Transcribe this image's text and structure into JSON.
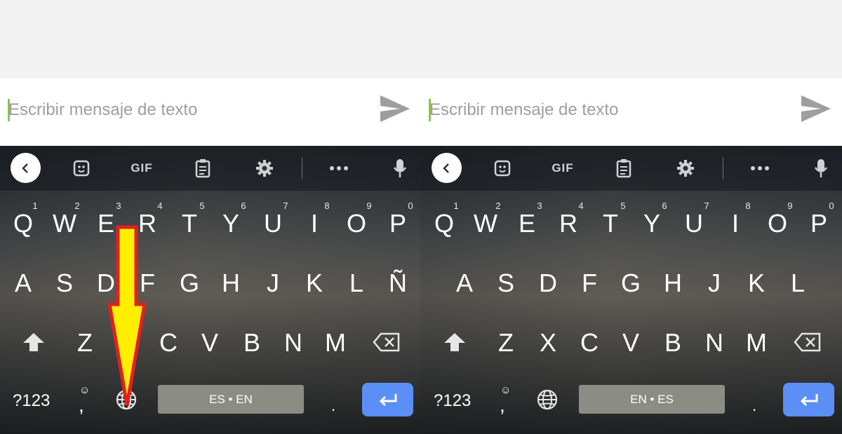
{
  "panels": [
    {
      "id": "left",
      "input": {
        "placeholder": "Escribir mensaje de texto"
      },
      "toolbar": {
        "gif_label": "GIF"
      },
      "rows": {
        "row1": [
          "Q",
          "W",
          "E",
          "R",
          "T",
          "Y",
          "U",
          "I",
          "O",
          "P"
        ],
        "row1_numbers": [
          "1",
          "2",
          "3",
          "4",
          "5",
          "6",
          "7",
          "8",
          "9",
          "0"
        ],
        "row2": [
          "A",
          "S",
          "D",
          "F",
          "G",
          "H",
          "J",
          "K",
          "L",
          "Ñ"
        ],
        "row3": [
          "Z",
          "C",
          "V",
          "B",
          "N",
          "M"
        ]
      },
      "bottom": {
        "symbols": "?123",
        "comma": ",",
        "space_label": "ES • EN",
        "period": "."
      },
      "annotation": {
        "arrow_color": "#ffee00",
        "arrow_outline": "#e02020",
        "points_to": "globe-icon"
      }
    },
    {
      "id": "right",
      "input": {
        "placeholder": "Escribir mensaje de texto"
      },
      "toolbar": {
        "gif_label": "GIF"
      },
      "rows": {
        "row1": [
          "Q",
          "W",
          "E",
          "R",
          "T",
          "Y",
          "U",
          "I",
          "O",
          "P"
        ],
        "row1_numbers": [
          "1",
          "2",
          "3",
          "4",
          "5",
          "6",
          "7",
          "8",
          "9",
          "0"
        ],
        "row2": [
          "A",
          "S",
          "D",
          "F",
          "G",
          "H",
          "J",
          "K",
          "L"
        ],
        "row3": [
          "Z",
          "X",
          "C",
          "V",
          "B",
          "N",
          "M"
        ]
      },
      "bottom": {
        "symbols": "?123",
        "comma": ",",
        "space_label": "EN • ES",
        "period": "."
      }
    }
  ],
  "colors": {
    "accent_cursor": "#8bc34a",
    "enter_key": "#5b8ff5",
    "space_bar": "#8b8d84"
  },
  "icons": [
    "send-icon",
    "back-icon",
    "sticker-icon",
    "clipboard-icon",
    "gear-icon",
    "more-icon",
    "mic-icon",
    "shift-icon",
    "backspace-icon",
    "smiley-icon",
    "globe-icon",
    "enter-icon"
  ]
}
